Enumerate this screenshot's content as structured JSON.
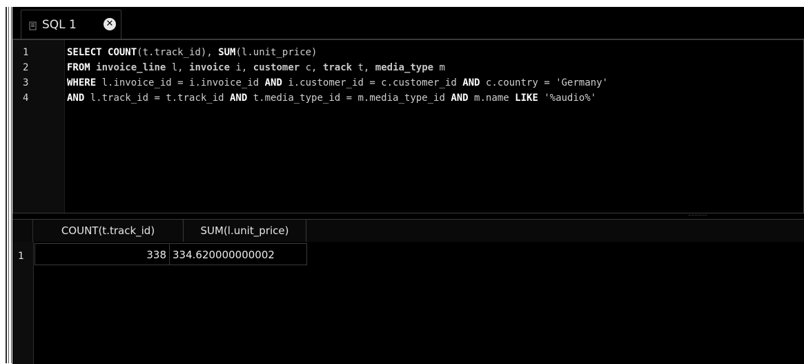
{
  "tab": {
    "label": "SQL 1",
    "icon": "document-icon",
    "close_icon": "close-circle-icon"
  },
  "editor": {
    "line_numbers": [
      "1",
      "2",
      "3",
      "4"
    ],
    "lines": [
      [
        {
          "t": "SELECT",
          "c": "kw"
        },
        {
          "t": " ",
          "c": ""
        },
        {
          "t": "COUNT",
          "c": "kw"
        },
        {
          "t": "(t.track_id), ",
          "c": ""
        },
        {
          "t": "SUM",
          "c": "kw"
        },
        {
          "t": "(l.unit_price)",
          "c": ""
        }
      ],
      [
        {
          "t": "FROM",
          "c": "kw"
        },
        {
          "t": " ",
          "c": ""
        },
        {
          "t": "invoice_line",
          "c": "id"
        },
        {
          "t": " l, ",
          "c": ""
        },
        {
          "t": "invoice",
          "c": "id"
        },
        {
          "t": " i, ",
          "c": ""
        },
        {
          "t": "customer",
          "c": "id"
        },
        {
          "t": " c, ",
          "c": ""
        },
        {
          "t": "track",
          "c": "id"
        },
        {
          "t": " t, ",
          "c": ""
        },
        {
          "t": "media_type",
          "c": "id"
        },
        {
          "t": " m",
          "c": ""
        }
      ],
      [
        {
          "t": "WHERE",
          "c": "kw"
        },
        {
          "t": " l.invoice_id = i.invoice_id ",
          "c": ""
        },
        {
          "t": "AND",
          "c": "kw"
        },
        {
          "t": " i.customer_id = c.customer_id ",
          "c": ""
        },
        {
          "t": "AND",
          "c": "kw"
        },
        {
          "t": " c.country = ",
          "c": ""
        },
        {
          "t": "'Germany'",
          "c": "str"
        }
      ],
      [
        {
          "t": "AND",
          "c": "kw"
        },
        {
          "t": " l.track_id = t.track_id ",
          "c": ""
        },
        {
          "t": "AND",
          "c": "kw"
        },
        {
          "t": " t.media_type_id = m.media_type_id ",
          "c": ""
        },
        {
          "t": "AND",
          "c": "kw"
        },
        {
          "t": " m.name ",
          "c": ""
        },
        {
          "t": "LIKE",
          "c": "kw"
        },
        {
          "t": " ",
          "c": ""
        },
        {
          "t": "'%audio%'",
          "c": "str"
        }
      ]
    ]
  },
  "results": {
    "columns": [
      "COUNT(t.track_id)",
      "SUM(l.unit_price)"
    ],
    "rows": [
      {
        "num": "1",
        "cells": [
          "338",
          "334.620000000002"
        ]
      }
    ]
  }
}
